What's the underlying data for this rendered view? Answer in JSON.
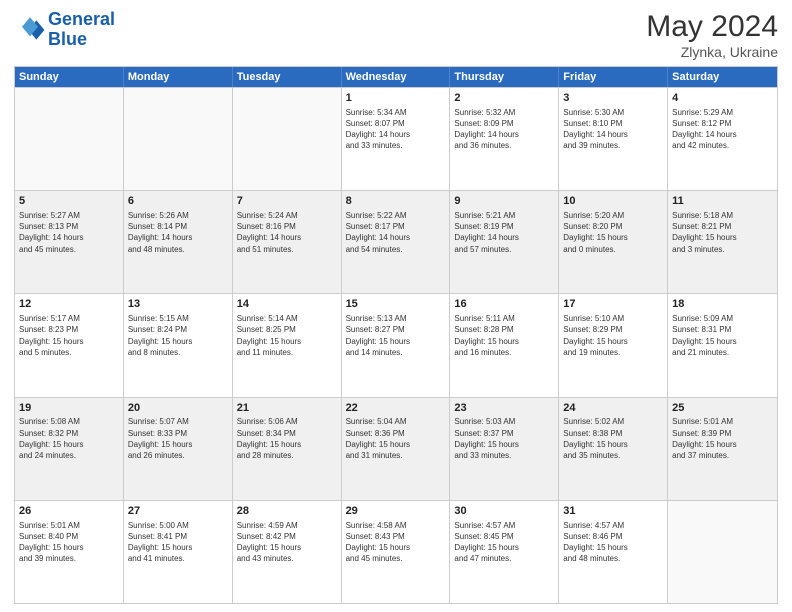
{
  "header": {
    "logo_general": "General",
    "logo_blue": "Blue",
    "month_year": "May 2024",
    "location": "Zlynka, Ukraine"
  },
  "days_of_week": [
    "Sunday",
    "Monday",
    "Tuesday",
    "Wednesday",
    "Thursday",
    "Friday",
    "Saturday"
  ],
  "weeks": [
    [
      {
        "day": "",
        "lines": [],
        "empty": true
      },
      {
        "day": "",
        "lines": [],
        "empty": true
      },
      {
        "day": "",
        "lines": [],
        "empty": true
      },
      {
        "day": "1",
        "lines": [
          "Sunrise: 5:34 AM",
          "Sunset: 8:07 PM",
          "Daylight: 14 hours",
          "and 33 minutes."
        ]
      },
      {
        "day": "2",
        "lines": [
          "Sunrise: 5:32 AM",
          "Sunset: 8:09 PM",
          "Daylight: 14 hours",
          "and 36 minutes."
        ]
      },
      {
        "day": "3",
        "lines": [
          "Sunrise: 5:30 AM",
          "Sunset: 8:10 PM",
          "Daylight: 14 hours",
          "and 39 minutes."
        ]
      },
      {
        "day": "4",
        "lines": [
          "Sunrise: 5:29 AM",
          "Sunset: 8:12 PM",
          "Daylight: 14 hours",
          "and 42 minutes."
        ]
      }
    ],
    [
      {
        "day": "5",
        "lines": [
          "Sunrise: 5:27 AM",
          "Sunset: 8:13 PM",
          "Daylight: 14 hours",
          "and 45 minutes."
        ]
      },
      {
        "day": "6",
        "lines": [
          "Sunrise: 5:26 AM",
          "Sunset: 8:14 PM",
          "Daylight: 14 hours",
          "and 48 minutes."
        ]
      },
      {
        "day": "7",
        "lines": [
          "Sunrise: 5:24 AM",
          "Sunset: 8:16 PM",
          "Daylight: 14 hours",
          "and 51 minutes."
        ]
      },
      {
        "day": "8",
        "lines": [
          "Sunrise: 5:22 AM",
          "Sunset: 8:17 PM",
          "Daylight: 14 hours",
          "and 54 minutes."
        ]
      },
      {
        "day": "9",
        "lines": [
          "Sunrise: 5:21 AM",
          "Sunset: 8:19 PM",
          "Daylight: 14 hours",
          "and 57 minutes."
        ]
      },
      {
        "day": "10",
        "lines": [
          "Sunrise: 5:20 AM",
          "Sunset: 8:20 PM",
          "Daylight: 15 hours",
          "and 0 minutes."
        ]
      },
      {
        "day": "11",
        "lines": [
          "Sunrise: 5:18 AM",
          "Sunset: 8:21 PM",
          "Daylight: 15 hours",
          "and 3 minutes."
        ]
      }
    ],
    [
      {
        "day": "12",
        "lines": [
          "Sunrise: 5:17 AM",
          "Sunset: 8:23 PM",
          "Daylight: 15 hours",
          "and 5 minutes."
        ]
      },
      {
        "day": "13",
        "lines": [
          "Sunrise: 5:15 AM",
          "Sunset: 8:24 PM",
          "Daylight: 15 hours",
          "and 8 minutes."
        ]
      },
      {
        "day": "14",
        "lines": [
          "Sunrise: 5:14 AM",
          "Sunset: 8:25 PM",
          "Daylight: 15 hours",
          "and 11 minutes."
        ]
      },
      {
        "day": "15",
        "lines": [
          "Sunrise: 5:13 AM",
          "Sunset: 8:27 PM",
          "Daylight: 15 hours",
          "and 14 minutes."
        ]
      },
      {
        "day": "16",
        "lines": [
          "Sunrise: 5:11 AM",
          "Sunset: 8:28 PM",
          "Daylight: 15 hours",
          "and 16 minutes."
        ]
      },
      {
        "day": "17",
        "lines": [
          "Sunrise: 5:10 AM",
          "Sunset: 8:29 PM",
          "Daylight: 15 hours",
          "and 19 minutes."
        ]
      },
      {
        "day": "18",
        "lines": [
          "Sunrise: 5:09 AM",
          "Sunset: 8:31 PM",
          "Daylight: 15 hours",
          "and 21 minutes."
        ]
      }
    ],
    [
      {
        "day": "19",
        "lines": [
          "Sunrise: 5:08 AM",
          "Sunset: 8:32 PM",
          "Daylight: 15 hours",
          "and 24 minutes."
        ]
      },
      {
        "day": "20",
        "lines": [
          "Sunrise: 5:07 AM",
          "Sunset: 8:33 PM",
          "Daylight: 15 hours",
          "and 26 minutes."
        ]
      },
      {
        "day": "21",
        "lines": [
          "Sunrise: 5:06 AM",
          "Sunset: 8:34 PM",
          "Daylight: 15 hours",
          "and 28 minutes."
        ]
      },
      {
        "day": "22",
        "lines": [
          "Sunrise: 5:04 AM",
          "Sunset: 8:36 PM",
          "Daylight: 15 hours",
          "and 31 minutes."
        ]
      },
      {
        "day": "23",
        "lines": [
          "Sunrise: 5:03 AM",
          "Sunset: 8:37 PM",
          "Daylight: 15 hours",
          "and 33 minutes."
        ]
      },
      {
        "day": "24",
        "lines": [
          "Sunrise: 5:02 AM",
          "Sunset: 8:38 PM",
          "Daylight: 15 hours",
          "and 35 minutes."
        ]
      },
      {
        "day": "25",
        "lines": [
          "Sunrise: 5:01 AM",
          "Sunset: 8:39 PM",
          "Daylight: 15 hours",
          "and 37 minutes."
        ]
      }
    ],
    [
      {
        "day": "26",
        "lines": [
          "Sunrise: 5:01 AM",
          "Sunset: 8:40 PM",
          "Daylight: 15 hours",
          "and 39 minutes."
        ]
      },
      {
        "day": "27",
        "lines": [
          "Sunrise: 5:00 AM",
          "Sunset: 8:41 PM",
          "Daylight: 15 hours",
          "and 41 minutes."
        ]
      },
      {
        "day": "28",
        "lines": [
          "Sunrise: 4:59 AM",
          "Sunset: 8:42 PM",
          "Daylight: 15 hours",
          "and 43 minutes."
        ]
      },
      {
        "day": "29",
        "lines": [
          "Sunrise: 4:58 AM",
          "Sunset: 8:43 PM",
          "Daylight: 15 hours",
          "and 45 minutes."
        ]
      },
      {
        "day": "30",
        "lines": [
          "Sunrise: 4:57 AM",
          "Sunset: 8:45 PM",
          "Daylight: 15 hours",
          "and 47 minutes."
        ]
      },
      {
        "day": "31",
        "lines": [
          "Sunrise: 4:57 AM",
          "Sunset: 8:46 PM",
          "Daylight: 15 hours",
          "and 48 minutes."
        ]
      },
      {
        "day": "",
        "lines": [],
        "empty": true
      }
    ]
  ]
}
